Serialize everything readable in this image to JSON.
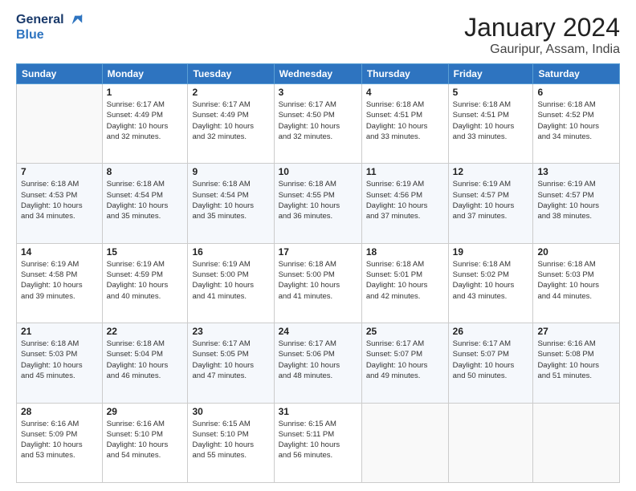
{
  "logo": {
    "line1": "General",
    "line2": "Blue"
  },
  "title": "January 2024",
  "subtitle": "Gauripur, Assam, India",
  "days_of_week": [
    "Sunday",
    "Monday",
    "Tuesday",
    "Wednesday",
    "Thursday",
    "Friday",
    "Saturday"
  ],
  "weeks": [
    [
      {
        "day": "",
        "info": ""
      },
      {
        "day": "1",
        "info": "Sunrise: 6:17 AM\nSunset: 4:49 PM\nDaylight: 10 hours\nand 32 minutes."
      },
      {
        "day": "2",
        "info": "Sunrise: 6:17 AM\nSunset: 4:49 PM\nDaylight: 10 hours\nand 32 minutes."
      },
      {
        "day": "3",
        "info": "Sunrise: 6:17 AM\nSunset: 4:50 PM\nDaylight: 10 hours\nand 32 minutes."
      },
      {
        "day": "4",
        "info": "Sunrise: 6:18 AM\nSunset: 4:51 PM\nDaylight: 10 hours\nand 33 minutes."
      },
      {
        "day": "5",
        "info": "Sunrise: 6:18 AM\nSunset: 4:51 PM\nDaylight: 10 hours\nand 33 minutes."
      },
      {
        "day": "6",
        "info": "Sunrise: 6:18 AM\nSunset: 4:52 PM\nDaylight: 10 hours\nand 34 minutes."
      }
    ],
    [
      {
        "day": "7",
        "info": "Sunrise: 6:18 AM\nSunset: 4:53 PM\nDaylight: 10 hours\nand 34 minutes."
      },
      {
        "day": "8",
        "info": "Sunrise: 6:18 AM\nSunset: 4:54 PM\nDaylight: 10 hours\nand 35 minutes."
      },
      {
        "day": "9",
        "info": "Sunrise: 6:18 AM\nSunset: 4:54 PM\nDaylight: 10 hours\nand 35 minutes."
      },
      {
        "day": "10",
        "info": "Sunrise: 6:18 AM\nSunset: 4:55 PM\nDaylight: 10 hours\nand 36 minutes."
      },
      {
        "day": "11",
        "info": "Sunrise: 6:19 AM\nSunset: 4:56 PM\nDaylight: 10 hours\nand 37 minutes."
      },
      {
        "day": "12",
        "info": "Sunrise: 6:19 AM\nSunset: 4:57 PM\nDaylight: 10 hours\nand 37 minutes."
      },
      {
        "day": "13",
        "info": "Sunrise: 6:19 AM\nSunset: 4:57 PM\nDaylight: 10 hours\nand 38 minutes."
      }
    ],
    [
      {
        "day": "14",
        "info": "Sunrise: 6:19 AM\nSunset: 4:58 PM\nDaylight: 10 hours\nand 39 minutes."
      },
      {
        "day": "15",
        "info": "Sunrise: 6:19 AM\nSunset: 4:59 PM\nDaylight: 10 hours\nand 40 minutes."
      },
      {
        "day": "16",
        "info": "Sunrise: 6:19 AM\nSunset: 5:00 PM\nDaylight: 10 hours\nand 41 minutes."
      },
      {
        "day": "17",
        "info": "Sunrise: 6:18 AM\nSunset: 5:00 PM\nDaylight: 10 hours\nand 41 minutes."
      },
      {
        "day": "18",
        "info": "Sunrise: 6:18 AM\nSunset: 5:01 PM\nDaylight: 10 hours\nand 42 minutes."
      },
      {
        "day": "19",
        "info": "Sunrise: 6:18 AM\nSunset: 5:02 PM\nDaylight: 10 hours\nand 43 minutes."
      },
      {
        "day": "20",
        "info": "Sunrise: 6:18 AM\nSunset: 5:03 PM\nDaylight: 10 hours\nand 44 minutes."
      }
    ],
    [
      {
        "day": "21",
        "info": "Sunrise: 6:18 AM\nSunset: 5:03 PM\nDaylight: 10 hours\nand 45 minutes."
      },
      {
        "day": "22",
        "info": "Sunrise: 6:18 AM\nSunset: 5:04 PM\nDaylight: 10 hours\nand 46 minutes."
      },
      {
        "day": "23",
        "info": "Sunrise: 6:17 AM\nSunset: 5:05 PM\nDaylight: 10 hours\nand 47 minutes."
      },
      {
        "day": "24",
        "info": "Sunrise: 6:17 AM\nSunset: 5:06 PM\nDaylight: 10 hours\nand 48 minutes."
      },
      {
        "day": "25",
        "info": "Sunrise: 6:17 AM\nSunset: 5:07 PM\nDaylight: 10 hours\nand 49 minutes."
      },
      {
        "day": "26",
        "info": "Sunrise: 6:17 AM\nSunset: 5:07 PM\nDaylight: 10 hours\nand 50 minutes."
      },
      {
        "day": "27",
        "info": "Sunrise: 6:16 AM\nSunset: 5:08 PM\nDaylight: 10 hours\nand 51 minutes."
      }
    ],
    [
      {
        "day": "28",
        "info": "Sunrise: 6:16 AM\nSunset: 5:09 PM\nDaylight: 10 hours\nand 53 minutes."
      },
      {
        "day": "29",
        "info": "Sunrise: 6:16 AM\nSunset: 5:10 PM\nDaylight: 10 hours\nand 54 minutes."
      },
      {
        "day": "30",
        "info": "Sunrise: 6:15 AM\nSunset: 5:10 PM\nDaylight: 10 hours\nand 55 minutes."
      },
      {
        "day": "31",
        "info": "Sunrise: 6:15 AM\nSunset: 5:11 PM\nDaylight: 10 hours\nand 56 minutes."
      },
      {
        "day": "",
        "info": ""
      },
      {
        "day": "",
        "info": ""
      },
      {
        "day": "",
        "info": ""
      }
    ]
  ]
}
